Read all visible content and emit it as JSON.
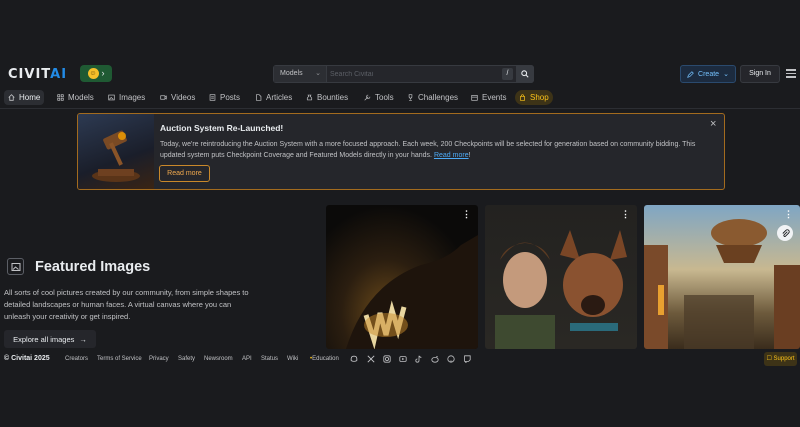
{
  "header": {
    "logo_main": "CIVIT",
    "logo_accent": "AI",
    "search": {
      "scope": "Models",
      "placeholder": "Search Civitai",
      "shortcut_key": "/"
    },
    "create_label": "Create",
    "signin_label": "Sign In"
  },
  "nav": {
    "items": [
      {
        "label": "Home",
        "icon": "home-icon"
      },
      {
        "label": "Models",
        "icon": "grid-icon"
      },
      {
        "label": "Images",
        "icon": "photo-icon"
      },
      {
        "label": "Videos",
        "icon": "video-icon"
      },
      {
        "label": "Posts",
        "icon": "posts-icon"
      },
      {
        "label": "Articles",
        "icon": "article-icon"
      },
      {
        "label": "Bounties",
        "icon": "bounty-icon"
      },
      {
        "label": "Tools",
        "icon": "tools-icon"
      },
      {
        "label": "Challenges",
        "icon": "trophy-icon"
      },
      {
        "label": "Events",
        "icon": "calendar-icon"
      },
      {
        "label": "Shop",
        "icon": "shopping-bag-icon"
      }
    ]
  },
  "banner": {
    "title": "Auction System Re-Launched!",
    "text": "Today, we're reintroducing the Auction System with a more focused approach. Each week, 200 Checkpoints will be selected for generation based on community bidding. This updated system puts Checkpoint Coverage and Featured Models directly in your hands.",
    "link_text": "Read more",
    "link_suffix": "!",
    "button_label": "Read more"
  },
  "featured": {
    "title": "Featured Images",
    "description": "All sorts of cool pictures created by our community, from simple shapes to detailed landscapes or human faces. A virtual canvas where you can unleash your creativity or get inspired.",
    "explore_label": "Explore all images"
  },
  "footer": {
    "copyright": "© Civitai 2025",
    "links": [
      "Creators",
      "Terms of Service",
      "Privacy",
      "Safety",
      "Newsroom",
      "API",
      "Status",
      "Wiki",
      "Education"
    ],
    "support_label": "Support"
  },
  "colors": {
    "background": "#1a1b1e",
    "accent_blue": "#228be6",
    "banner_border": "#a36b1e",
    "shop_gold": "#fcc419"
  }
}
